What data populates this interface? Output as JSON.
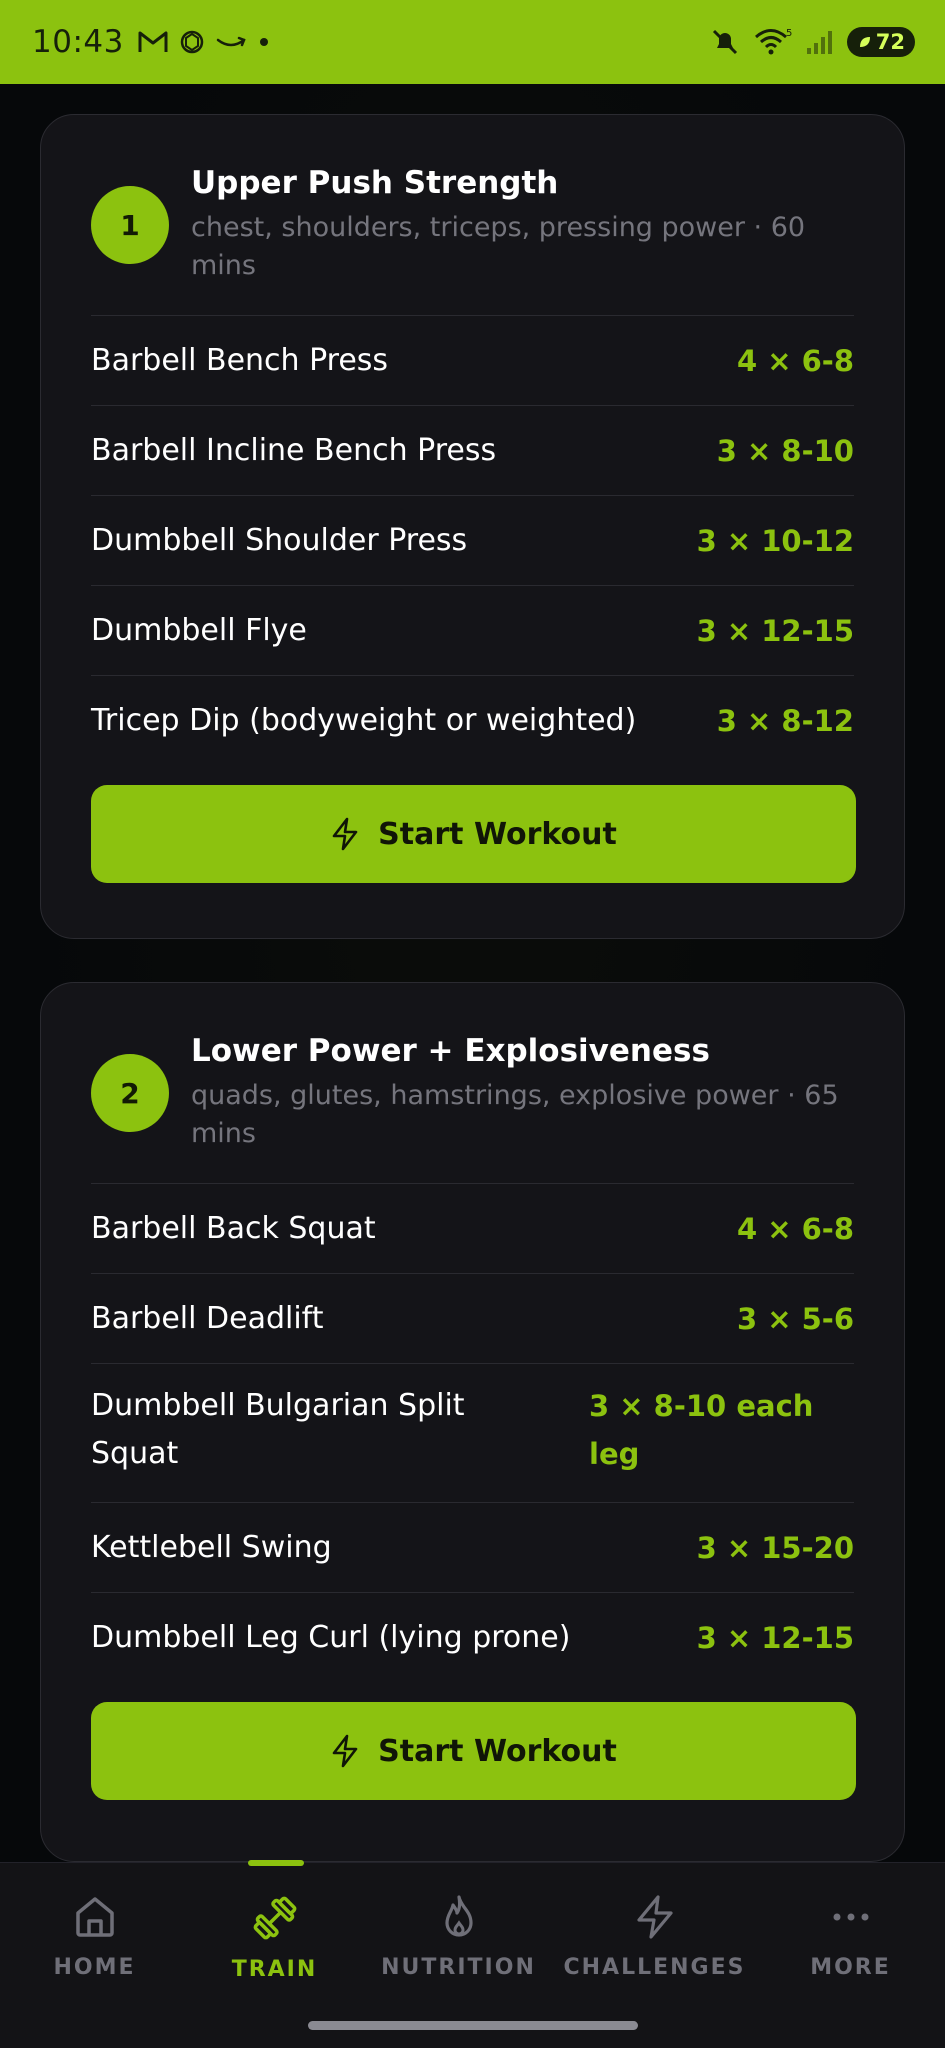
{
  "status_bar": {
    "time": "10:43",
    "battery": "72"
  },
  "workouts": [
    {
      "day": "1",
      "title": "Upper Push Strength",
      "subtitle": "chest, shoulders, triceps, pressing power · 60 mins",
      "exercises": [
        {
          "name": "Barbell Bench Press",
          "sets": "4 × 6-8"
        },
        {
          "name": "Barbell Incline Bench Press",
          "sets": "3 × 8-10"
        },
        {
          "name": "Dumbbell Shoulder Press",
          "sets": "3 × 10-12"
        },
        {
          "name": "Dumbbell Flye",
          "sets": "3 × 12-15"
        },
        {
          "name": "Tricep Dip (bodyweight or weighted)",
          "sets": "3 × 8-12"
        }
      ],
      "button_label": "Start Workout"
    },
    {
      "day": "2",
      "title": "Lower Power + Explosiveness",
      "subtitle": "quads, glutes, hamstrings, explosive power · 65 mins",
      "exercises": [
        {
          "name": "Barbell Back Squat",
          "sets": "4 × 6-8"
        },
        {
          "name": "Barbell Deadlift",
          "sets": "3 × 5-6"
        },
        {
          "name": "Dumbbell Bulgarian Split Squat",
          "sets": "3 × 8-10 each leg"
        },
        {
          "name": "Kettlebell Swing",
          "sets": "3 × 15-20"
        },
        {
          "name": "Dumbbell Leg Curl (lying prone)",
          "sets": "3 × 12-15"
        }
      ],
      "button_label": "Start Workout"
    }
  ],
  "nav": {
    "active": "TRAIN",
    "items": [
      {
        "label": "HOME",
        "icon": "home-icon"
      },
      {
        "label": "TRAIN",
        "icon": "dumbbell-icon"
      },
      {
        "label": "NUTRITION",
        "icon": "flame-icon"
      },
      {
        "label": "CHALLENGES",
        "icon": "lightning-icon"
      },
      {
        "label": "MORE",
        "icon": "more-icon"
      }
    ]
  },
  "colors": {
    "accent": "#8cc20f",
    "background": "#0c0c0f",
    "card": "#141418"
  }
}
